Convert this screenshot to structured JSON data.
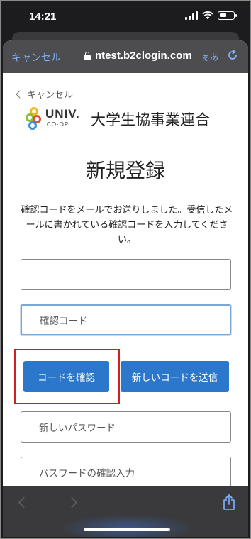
{
  "status": {
    "time": "14:21"
  },
  "browser": {
    "cancel_label": "キャンセル",
    "domain": "ntest.b2clogin.com",
    "text_size_label": "ぁあ"
  },
  "page": {
    "back_label": "キャンセル",
    "logo": {
      "univ": "UNIV.",
      "coop": "CO·OP",
      "org": "大学生協事業連合"
    },
    "title": "新規登録",
    "message": "確認コードをメールでお送りしました。受信したメールに書かれている確認コードを入力してください。",
    "email_field": {
      "value": "",
      "placeholder": ""
    },
    "code_field": {
      "placeholder": "確認コード"
    },
    "verify_button": "コードを確認",
    "resend_button": "新しいコードを送信",
    "new_password": {
      "placeholder": "新しいパスワード"
    },
    "confirm_password": {
      "placeholder": "パスワードの確認入力"
    }
  },
  "colors": {
    "accent": "#2b77cc",
    "highlight": "#d02020",
    "link": "#7fb3ff"
  },
  "icons": [
    "lock-icon",
    "reload-icon",
    "chevron-left-icon",
    "share-icon",
    "wifi-icon",
    "battery-icon",
    "signal-icon"
  ]
}
